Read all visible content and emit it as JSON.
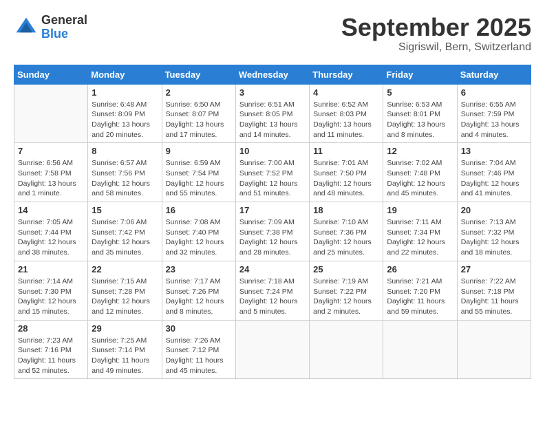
{
  "header": {
    "logo_general": "General",
    "logo_blue": "Blue",
    "month_title": "September 2025",
    "location": "Sigriswil, Bern, Switzerland"
  },
  "calendar": {
    "days_of_week": [
      "Sunday",
      "Monday",
      "Tuesday",
      "Wednesday",
      "Thursday",
      "Friday",
      "Saturday"
    ],
    "weeks": [
      [
        {
          "day": "",
          "info": ""
        },
        {
          "day": "1",
          "info": "Sunrise: 6:48 AM\nSunset: 8:09 PM\nDaylight: 13 hours\nand 20 minutes."
        },
        {
          "day": "2",
          "info": "Sunrise: 6:50 AM\nSunset: 8:07 PM\nDaylight: 13 hours\nand 17 minutes."
        },
        {
          "day": "3",
          "info": "Sunrise: 6:51 AM\nSunset: 8:05 PM\nDaylight: 13 hours\nand 14 minutes."
        },
        {
          "day": "4",
          "info": "Sunrise: 6:52 AM\nSunset: 8:03 PM\nDaylight: 13 hours\nand 11 minutes."
        },
        {
          "day": "5",
          "info": "Sunrise: 6:53 AM\nSunset: 8:01 PM\nDaylight: 13 hours\nand 8 minutes."
        },
        {
          "day": "6",
          "info": "Sunrise: 6:55 AM\nSunset: 7:59 PM\nDaylight: 13 hours\nand 4 minutes."
        }
      ],
      [
        {
          "day": "7",
          "info": "Sunrise: 6:56 AM\nSunset: 7:58 PM\nDaylight: 13 hours\nand 1 minute."
        },
        {
          "day": "8",
          "info": "Sunrise: 6:57 AM\nSunset: 7:56 PM\nDaylight: 12 hours\nand 58 minutes."
        },
        {
          "day": "9",
          "info": "Sunrise: 6:59 AM\nSunset: 7:54 PM\nDaylight: 12 hours\nand 55 minutes."
        },
        {
          "day": "10",
          "info": "Sunrise: 7:00 AM\nSunset: 7:52 PM\nDaylight: 12 hours\nand 51 minutes."
        },
        {
          "day": "11",
          "info": "Sunrise: 7:01 AM\nSunset: 7:50 PM\nDaylight: 12 hours\nand 48 minutes."
        },
        {
          "day": "12",
          "info": "Sunrise: 7:02 AM\nSunset: 7:48 PM\nDaylight: 12 hours\nand 45 minutes."
        },
        {
          "day": "13",
          "info": "Sunrise: 7:04 AM\nSunset: 7:46 PM\nDaylight: 12 hours\nand 41 minutes."
        }
      ],
      [
        {
          "day": "14",
          "info": "Sunrise: 7:05 AM\nSunset: 7:44 PM\nDaylight: 12 hours\nand 38 minutes."
        },
        {
          "day": "15",
          "info": "Sunrise: 7:06 AM\nSunset: 7:42 PM\nDaylight: 12 hours\nand 35 minutes."
        },
        {
          "day": "16",
          "info": "Sunrise: 7:08 AM\nSunset: 7:40 PM\nDaylight: 12 hours\nand 32 minutes."
        },
        {
          "day": "17",
          "info": "Sunrise: 7:09 AM\nSunset: 7:38 PM\nDaylight: 12 hours\nand 28 minutes."
        },
        {
          "day": "18",
          "info": "Sunrise: 7:10 AM\nSunset: 7:36 PM\nDaylight: 12 hours\nand 25 minutes."
        },
        {
          "day": "19",
          "info": "Sunrise: 7:11 AM\nSunset: 7:34 PM\nDaylight: 12 hours\nand 22 minutes."
        },
        {
          "day": "20",
          "info": "Sunrise: 7:13 AM\nSunset: 7:32 PM\nDaylight: 12 hours\nand 18 minutes."
        }
      ],
      [
        {
          "day": "21",
          "info": "Sunrise: 7:14 AM\nSunset: 7:30 PM\nDaylight: 12 hours\nand 15 minutes."
        },
        {
          "day": "22",
          "info": "Sunrise: 7:15 AM\nSunset: 7:28 PM\nDaylight: 12 hours\nand 12 minutes."
        },
        {
          "day": "23",
          "info": "Sunrise: 7:17 AM\nSunset: 7:26 PM\nDaylight: 12 hours\nand 8 minutes."
        },
        {
          "day": "24",
          "info": "Sunrise: 7:18 AM\nSunset: 7:24 PM\nDaylight: 12 hours\nand 5 minutes."
        },
        {
          "day": "25",
          "info": "Sunrise: 7:19 AM\nSunset: 7:22 PM\nDaylight: 12 hours\nand 2 minutes."
        },
        {
          "day": "26",
          "info": "Sunrise: 7:21 AM\nSunset: 7:20 PM\nDaylight: 11 hours\nand 59 minutes."
        },
        {
          "day": "27",
          "info": "Sunrise: 7:22 AM\nSunset: 7:18 PM\nDaylight: 11 hours\nand 55 minutes."
        }
      ],
      [
        {
          "day": "28",
          "info": "Sunrise: 7:23 AM\nSunset: 7:16 PM\nDaylight: 11 hours\nand 52 minutes."
        },
        {
          "day": "29",
          "info": "Sunrise: 7:25 AM\nSunset: 7:14 PM\nDaylight: 11 hours\nand 49 minutes."
        },
        {
          "day": "30",
          "info": "Sunrise: 7:26 AM\nSunset: 7:12 PM\nDaylight: 11 hours\nand 45 minutes."
        },
        {
          "day": "",
          "info": ""
        },
        {
          "day": "",
          "info": ""
        },
        {
          "day": "",
          "info": ""
        },
        {
          "day": "",
          "info": ""
        }
      ]
    ]
  }
}
